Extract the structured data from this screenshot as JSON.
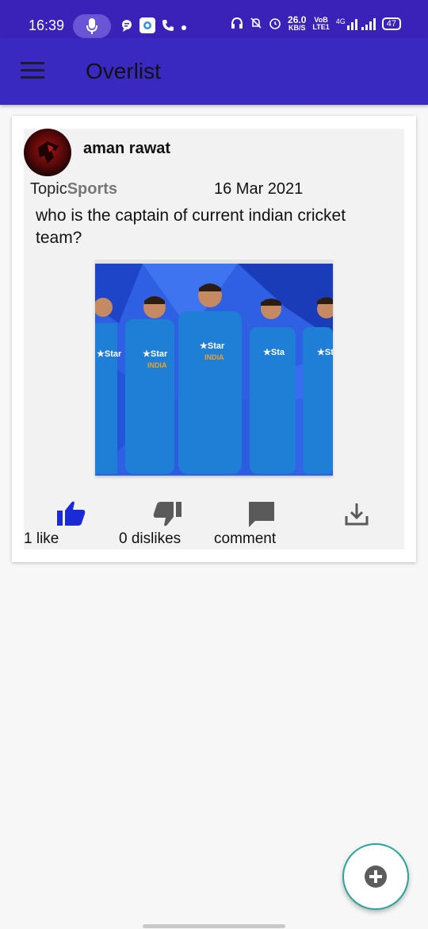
{
  "status_bar": {
    "time": "16:39",
    "speed_value": "26.0",
    "speed_unit": "KB/S",
    "volte_top": "VoB",
    "volte_bottom": "LTE1",
    "network": "4G",
    "battery": "47",
    "icons_left": [
      "mic-icon",
      "chat-icon",
      "camera-app-icon",
      "phone-icon",
      "dot-icon"
    ],
    "icons_right": [
      "headset-icon",
      "bell-off-icon",
      "alarm-icon",
      "signal-icon"
    ]
  },
  "app_bar": {
    "title": "Overlist",
    "menu_icon": "hamburger-menu-icon"
  },
  "post": {
    "author": "aman rawat",
    "topic_label": "Topic",
    "topic_value": "Sports",
    "date": "16 Mar 2021",
    "question": "who is the captain of current indian cricket team?",
    "image_alt": "indian cricket team players in blue jerseys",
    "actions": {
      "like_label": "1 like",
      "dislike_label": "0 dislikes",
      "comment_label": "comment",
      "like_icon": "thumbs-up-icon",
      "dislike_icon": "thumbs-down-icon",
      "comment_icon": "comment-icon",
      "download_icon": "download-icon"
    }
  },
  "fab": {
    "icon": "add-circle-icon"
  },
  "colors": {
    "status_bar": "#3a21b8",
    "app_bar": "#3a29c0",
    "like_active": "#1a2bd6",
    "icon_gray": "#5a5a5a",
    "fab_border": "#2aa49a"
  }
}
